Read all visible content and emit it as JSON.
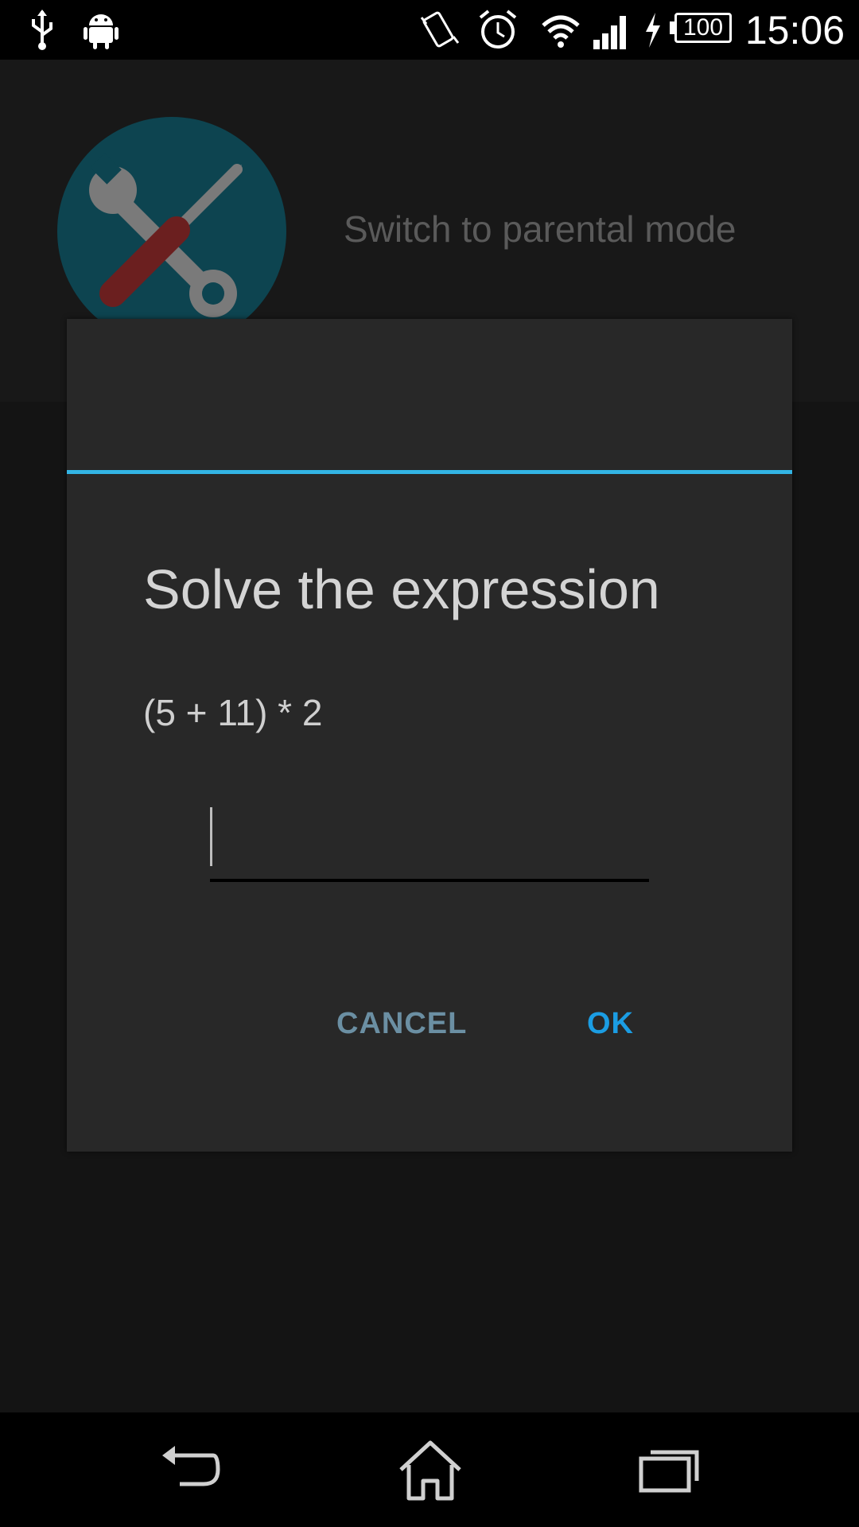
{
  "status_bar": {
    "time": "15:06",
    "battery_level": "100",
    "icons": [
      "usb-icon",
      "android-icon",
      "vibrate-icon",
      "alarm-icon",
      "wifi-icon",
      "signal-icon",
      "charging-icon"
    ]
  },
  "background": {
    "row_title": "Switch to parental mode",
    "avatar_icon": "tools-icon"
  },
  "dialog": {
    "heading": "Solve the expression",
    "expression": "(5 + 11) * 2",
    "answer_value": "",
    "cancel_label": "CANCEL",
    "ok_label": "OK",
    "accent_color": "#33b5e5"
  },
  "nav_bar": {
    "items": [
      "back-icon",
      "home-icon",
      "recents-icon"
    ]
  }
}
